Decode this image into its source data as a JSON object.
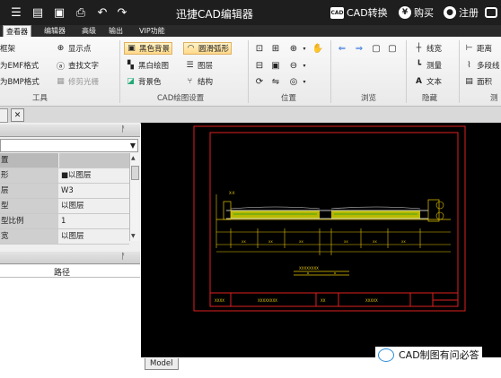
{
  "app_title": "迅捷CAD编辑器",
  "titlebar": {
    "quick_icons": [
      "menu-icon",
      "open-icon",
      "save-icon",
      "print-icon",
      "undo-icon",
      "redo-icon"
    ],
    "convert_icon": "CAD",
    "convert_label": "CAD转换",
    "buy_label": "购买",
    "register_label": "注册"
  },
  "menu_tabs": [
    "查看器",
    "编辑器",
    "高级",
    "输出",
    "VIP功能"
  ],
  "ribbon": {
    "tools": {
      "label": "工具",
      "items": [
        "框架",
        "为EMF格式",
        "为BMP格式"
      ],
      "items2": [
        "显示点",
        "查找文字",
        "修剪光栅"
      ]
    },
    "cad_settings": {
      "label": "CAD绘图设置",
      "items": [
        "黑色背景",
        "黑白绘图",
        "背景色"
      ],
      "items2": [
        "圆滑弧形",
        "图层",
        "结构"
      ]
    },
    "position": {
      "label": "位置"
    },
    "browse": {
      "label": "浏览"
    },
    "hide": {
      "label": "隐藏",
      "items": [
        "线宽",
        "测量",
        "文本"
      ]
    },
    "measure": {
      "items": [
        "距离",
        "多段线",
        "面积"
      ],
      "label_partial": "测"
    }
  },
  "left_panel": {
    "props": [
      {
        "key": "置",
        "value": ""
      },
      {
        "key": "形",
        "value": "■以图层"
      },
      {
        "key": "层",
        "value": "W3"
      },
      {
        "key": "型",
        "value": "以图层"
      },
      {
        "key": "型比例",
        "value": "1"
      },
      {
        "key": "宽",
        "value": "以图层"
      }
    ],
    "path_header": "路径"
  },
  "canvas": {
    "model_tab": "Model"
  },
  "watermark": "CAD制图有问必答"
}
